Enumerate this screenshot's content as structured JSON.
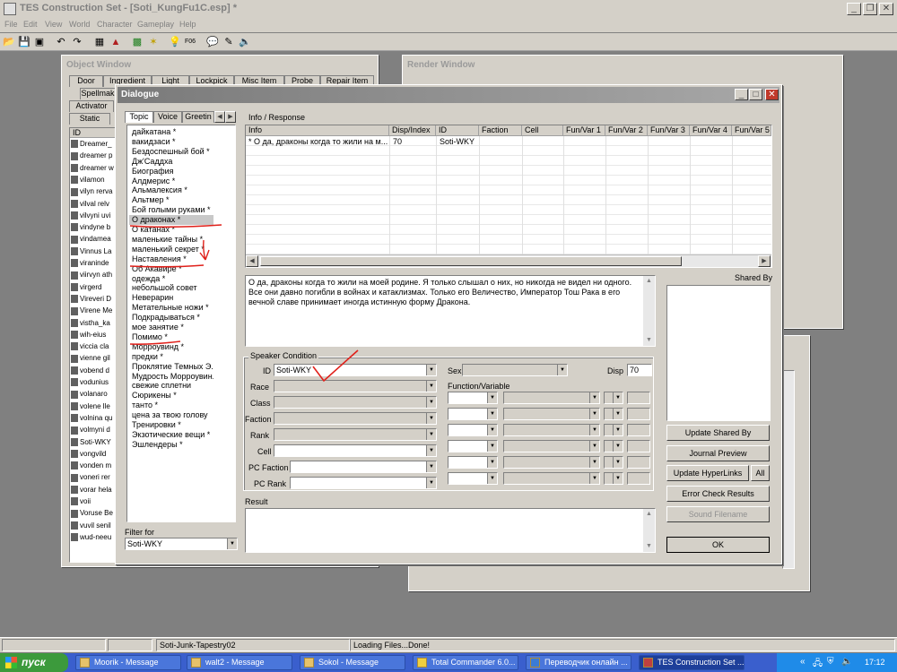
{
  "app": {
    "title": "TES Construction Set - [Soti_KungFu1C.esp] *",
    "menu": [
      "File",
      "Edit",
      "View",
      "World",
      "Character",
      "Gameplay",
      "Help"
    ]
  },
  "toolbar": {
    "icons": [
      "folder-open-icon",
      "save-icon",
      "save-all-icon",
      "undo-icon",
      "redo-icon",
      "grid-icon",
      "angle-icon",
      "landscape-icon",
      "light-icon",
      "lightbulb-icon",
      "fog-icon",
      "dialogue-icon",
      "pen-icon",
      "sound-icon"
    ],
    "fog_label": "F06"
  },
  "object_window": {
    "title": "Object Window",
    "tabs_row1": [
      "Door",
      "Ingredient",
      "Light",
      "Lockpick",
      "Misc Item",
      "Probe",
      "Repair Item"
    ],
    "tabs_row2": [
      "Spellmak"
    ],
    "tabs_row3": [
      "Activator"
    ],
    "tabs_row4": [
      "Static"
    ],
    "column_id": "ID",
    "items": [
      "Dreamer_",
      "dreamer p",
      "dreamer w",
      "vilamon",
      "vilyn rerva",
      "vilval relv",
      "vilvyni uvi",
      "vindyne b",
      "vindamea",
      "Vinnus La",
      "viraninde",
      "viirvyn ath",
      "virgerd",
      "Vireveri D",
      "Virene Me",
      "vistha_ka",
      "wih-eius",
      "viccia cla",
      "vienne gil",
      "vobend d",
      "vodunius",
      "volanaro",
      "volene lle",
      "volnina qu",
      "volmyni d",
      "Soti-WKY",
      "vongvild",
      "vonden m",
      "voneri rer",
      "vorar hela",
      "voii",
      "Voruse Be",
      "vuvil senil",
      "wud-neeu"
    ]
  },
  "render_window": {
    "title": "Render Window"
  },
  "dialogue": {
    "title": "Dialogue",
    "tabs": [
      "Topic",
      "Voice",
      "Greetin"
    ],
    "topics": [
      "дайкатана *",
      "вакидзаси *",
      "Бездоспешный бой *",
      "Дж'Саддха",
      "Биография",
      "Алдмерис *",
      "Альмалексия *",
      "Альтмер *",
      "Бой голыми руками *",
      "О драконах *",
      "О катанах *",
      "маленькие тайны *",
      "маленький секрет *",
      "Наставления *",
      "Об Акавире *",
      "одежда *",
      "небольшой совет",
      "Неверарин",
      "Метательные ножи *",
      "Подкрадываться *",
      "мое занятие *",
      "Помимо *",
      "Морроувинд *",
      "предки *",
      "Проклятие Темных Э...",
      "Мудрость Морроувин...",
      "свежие сплетни",
      "Сюрикены *",
      "танто *",
      "цена за твою голову",
      "Тренировки *",
      "Экзотические вещи *",
      "Эшлендеры *"
    ],
    "selected_topic_index": 9,
    "filter_label": "Filter for",
    "filter_value": "Soti-WKY",
    "info_response_label": "Info / Response",
    "columns": [
      "Info",
      "Disp/Index",
      "ID",
      "Faction",
      "Cell",
      "Fun/Var 1",
      "Fun/Var 2",
      "Fun/Var 3",
      "Fun/Var 4",
      "Fun/Var 5"
    ],
    "rows": [
      {
        "info": "* О да, драконы когда то жили на м...",
        "disp": "70",
        "id": "Soti-WKY",
        "faction": "",
        "cell": ""
      }
    ],
    "response_text": "О да, драконы когда то жили на моей родине. Я только слышал о них, но никогда не видел ни одного. Все они давно погибли в войнах и катаклизмах. Только его Величество, Император Тош Рака в его вечной славе принимает иногда истинную форму Дракона.",
    "shared_by_label": "Shared By",
    "speaker_condition_label": "Speaker Condition",
    "id_label": "ID",
    "id_value": "Soti-WKY",
    "race_label": "Race",
    "class_label": "Class",
    "faction_label": "Faction",
    "rank_label": "Rank",
    "cell_label": "Cell",
    "pc_faction_label": "PC Faction",
    "pc_rank_label": "PC Rank",
    "sex_label": "Sex",
    "disp_label": "Disp",
    "disp_value": "70",
    "function_variable_label": "Function/Variable",
    "result_label": "Result",
    "buttons": {
      "update_shared_by": "Update Shared By",
      "journal_preview": "Journal Preview",
      "update_hyperlinks": "Update HyperLinks",
      "all": "All",
      "error_check_results": "Error Check Results",
      "sound_filename": "Sound Filename",
      "ok": "OK"
    }
  },
  "status_bar": {
    "cell_1": "",
    "cell_2": "Soti-Junk-Tapestry02",
    "cell_3": "Loading Files...Done!"
  },
  "taskbar": {
    "start_label": "пуск",
    "tasks": [
      "Moorik - Message",
      "walt2 - Message",
      "Sokol - Message",
      "Total Commander 6.0...",
      "Переводчик онлайн ...",
      "TES Construction Set ..."
    ],
    "active_task_index": 5,
    "lang": "RU",
    "clock": "17:12"
  },
  "colors": {
    "window_face": "#d4d0c8",
    "desktop_gray": "#808080",
    "taskbar_blue": "#3a5fcd",
    "start_green": "#3c9a3c",
    "annotation_red": "#e0201a"
  }
}
